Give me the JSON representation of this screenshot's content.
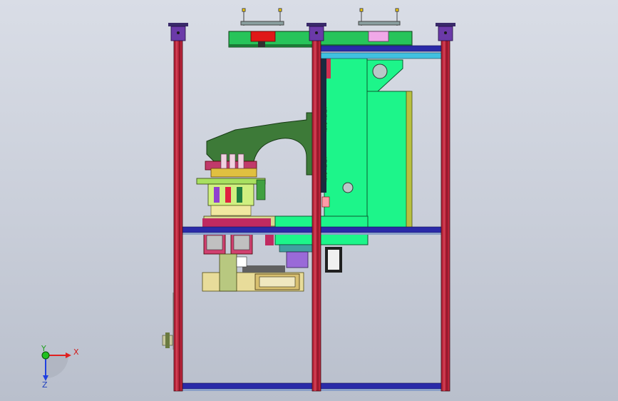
{
  "triad": {
    "x_label": "X",
    "y_label": "Y",
    "z_label": "Z",
    "colors": {
      "x": "#e02020",
      "y": "#20a020",
      "z": "#2040e0"
    }
  },
  "colors": {
    "frame_post": "#b8243a",
    "frame_cap": "#6b3aa8",
    "rail_blue": "#2a2aa8",
    "green_body": "#1df58a",
    "dark_green": "#3d7a38",
    "olive": "#a7b860",
    "magenta": "#c0286a",
    "background": "#cfd3dd"
  }
}
